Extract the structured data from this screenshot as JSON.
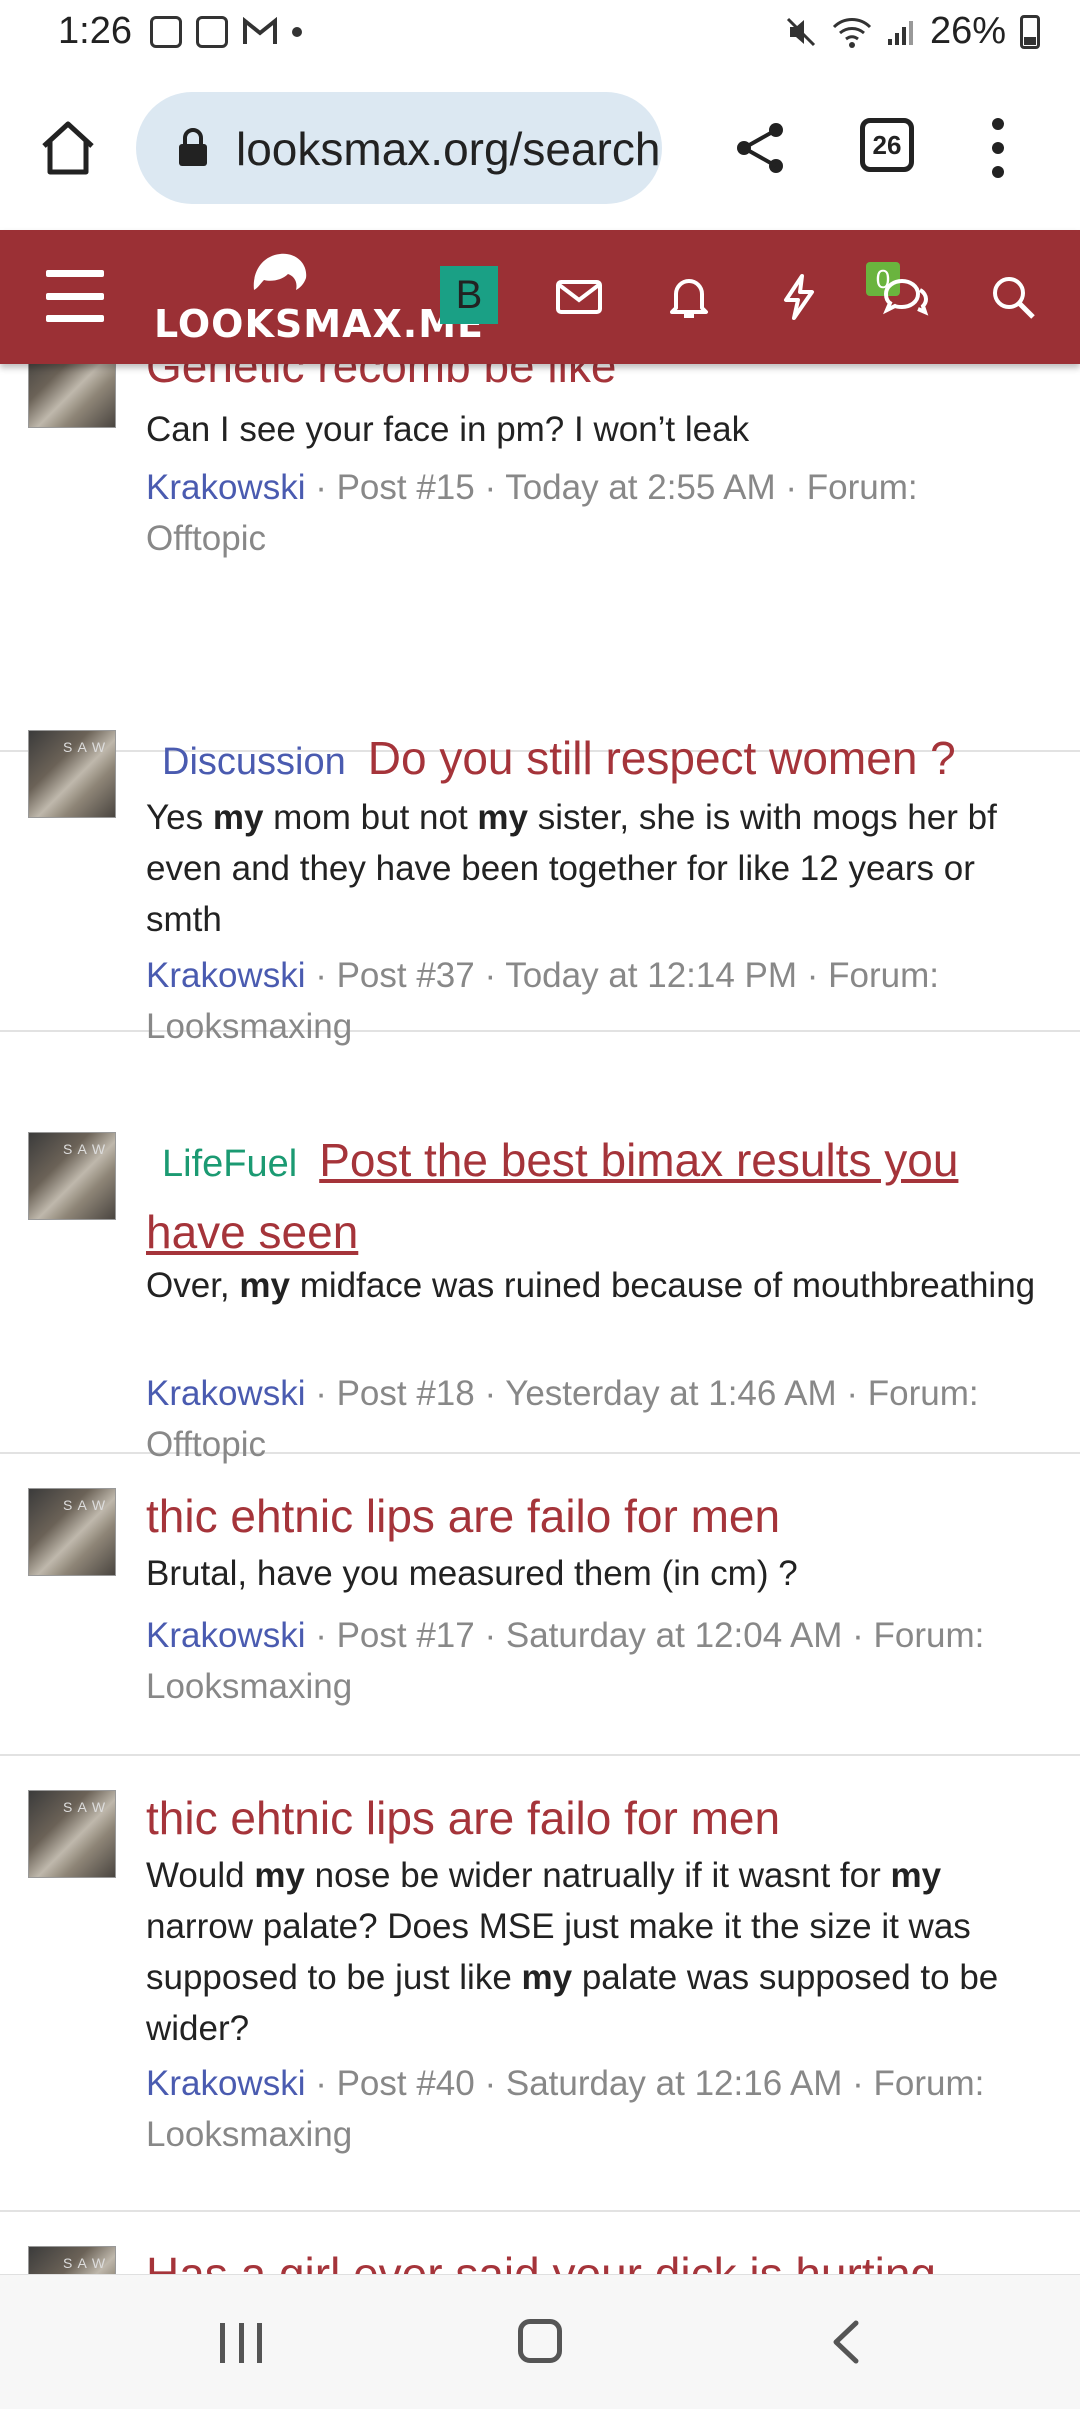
{
  "status_bar": {
    "time": "1:26",
    "battery": "26%"
  },
  "browser": {
    "url": "looksmax.org/search/",
    "tab_count": "26"
  },
  "site": {
    "logo_text": "LOOKSMAX.ME",
    "user_avatar_letter": "B",
    "conversations_badge": "0",
    "brand_color": "#9b3035"
  },
  "results": [
    {
      "prefix": "",
      "title": "Genetic recomb be like",
      "snippet_html": "Can I see your face in pm? I won’t leak",
      "user": "Krakowski",
      "meta": " · Post #15 · Today at 2:55 AM · Forum: Offtopic"
    },
    {
      "prefix": "Discussion",
      "title": "Do you still respect women ?",
      "snippet_html": "Yes <b>my</b> mom but not <b>my</b> sister, she is with mogs her bf even and they have been together for like 12 years or smth",
      "user": "Krakowski",
      "meta": " · Post #37 · Today at 12:14 PM · Forum: Looksmaxing"
    },
    {
      "prefix": "LifeFuel",
      "title": "Post the best bimax results you have seen",
      "snippet_html": "Over, <b>my</b> midface was ruined because of mouthbreathing",
      "user": "Krakowski",
      "meta": " · Post #18 · Yesterday at 1:46 AM · Forum: Offtopic"
    },
    {
      "prefix": "",
      "title": "thic ehtnic lips are failo for men",
      "snippet_html": "Brutal, have you measured them (in cm) ?",
      "user": "Krakowski",
      "meta": " · Post #17 · Saturday at 12:04 AM · Forum: Looksmaxing"
    },
    {
      "prefix": "",
      "title": "thic ehtnic lips are failo for men",
      "snippet_html": "Would <b>my</b> nose be wider natrually if it wasnt for <b>my</b> narrow palate? Does MSE just make it the size it was supposed to be just like <b>my</b> palate was supposed to be wider?",
      "user": "Krakowski",
      "meta": " · Post #40 · Saturday at 12:16 AM · Forum: Looksmaxing"
    },
    {
      "prefix": "",
      "title": "Has a girl ever said your dick is hurting",
      "snippet_html": "",
      "user": "",
      "meta": ""
    }
  ]
}
